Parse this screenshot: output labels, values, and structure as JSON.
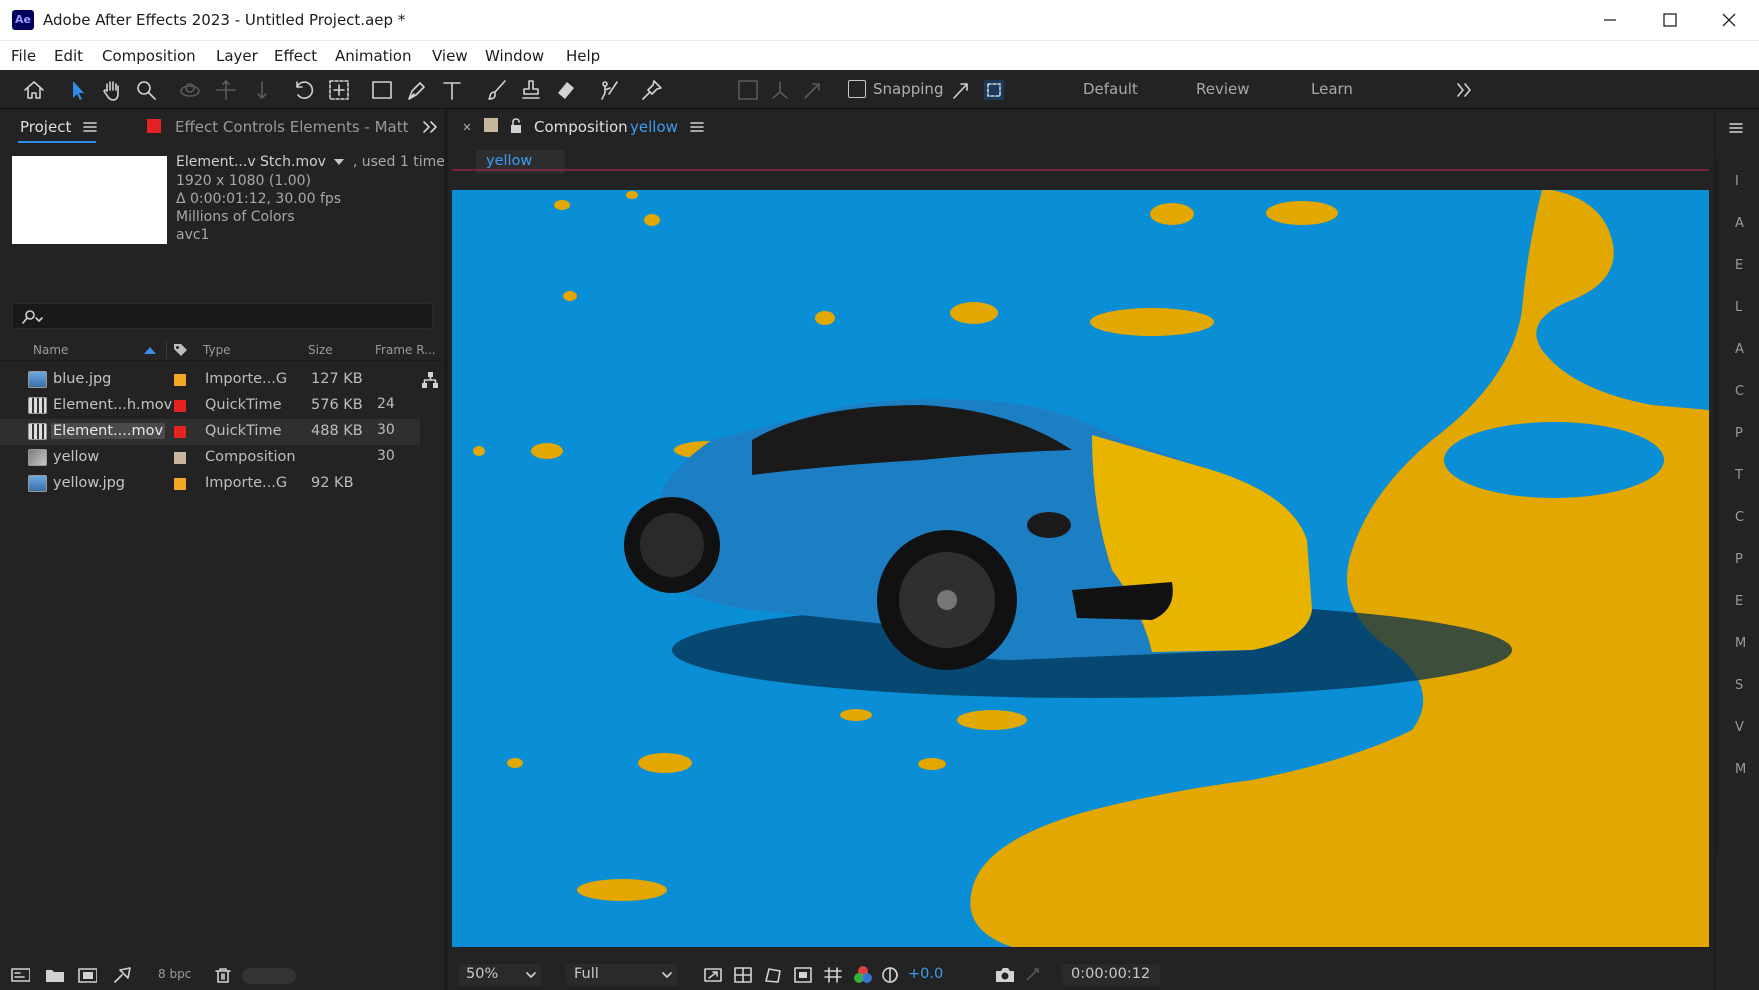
{
  "window": {
    "app_logo": "Ae",
    "title": "Adobe After Effects 2023 - Untitled Project.aep *",
    "controls": [
      "minimize-icon",
      "maximize-icon",
      "close-icon"
    ]
  },
  "menu": [
    "File",
    "Edit",
    "Composition",
    "Layer",
    "Effect",
    "Animation",
    "View",
    "Window",
    "Help"
  ],
  "toolbar": {
    "tools": [
      "home-icon",
      "selection-tool-icon",
      "hand-tool-icon",
      "zoom-tool-icon",
      "orbit-tool-icon",
      "pan-tool-icon",
      "dolly-tool-icon",
      "rotation-tool-icon",
      "pan-behind-tool-icon",
      "rectangle-tool-icon",
      "pen-tool-icon",
      "type-tool-icon",
      "brush-tool-icon",
      "clone-stamp-tool-icon",
      "eraser-tool-icon",
      "roto-brush-tool-icon",
      "puppet-pin-tool-icon"
    ],
    "snapping_label": "Snapping",
    "workspaces": [
      "Default",
      "Review",
      "Learn"
    ],
    "accent_color": "#2d8ceb"
  },
  "project_panel": {
    "tab_project": "Project",
    "tab_effect_controls": "Effect Controls Elements - Matt",
    "selected_info": {
      "name": "Element...v Stch.mov",
      "used": ", used 1 time",
      "line1": "1920 x 1080 (1.00)",
      "line2": "Δ 0:00:01:12, 30.00 fps",
      "line3": "Millions of Colors",
      "line4": "avc1"
    },
    "search_placeholder": "",
    "columns": {
      "name": "Name",
      "type": "Type",
      "size": "Size",
      "frame_rate": "Frame R..."
    },
    "items": [
      {
        "name": "blue.jpg",
        "label_color": "#f5a623",
        "type": "Importe...G",
        "size": "127 KB",
        "frame_rate": "",
        "icon": "image-file-icon"
      },
      {
        "name": "Element...h.mov",
        "label_color": "#e52222",
        "type": "QuickTime",
        "size": "576 KB",
        "frame_rate": "24",
        "icon": "video-file-icon"
      },
      {
        "name": "Element....mov",
        "label_color": "#e52222",
        "type": "QuickTime",
        "size": "488 KB",
        "frame_rate": "30",
        "icon": "video-file-icon",
        "selected": true
      },
      {
        "name": "yellow",
        "label_color": "#c8b79a",
        "type": "Composition",
        "size": "",
        "frame_rate": "30",
        "icon": "composition-icon"
      },
      {
        "name": "yellow.jpg",
        "label_color": "#f5a623",
        "type": "Importe...G",
        "size": "92 KB",
        "frame_rate": "",
        "icon": "image-file-icon"
      }
    ],
    "bit_depth": "8 bpc"
  },
  "composition_panel": {
    "tab_prefix": "Composition",
    "tab_name": "yellow",
    "subtab": "yellow",
    "viewer": {
      "background": "#0a8ed6",
      "paint": "#e2a700",
      "label": "blue sports car with yellow paint splash"
    },
    "zoom": "50%",
    "resolution": "Full",
    "exposure": "+0.0",
    "timecode": "0:00:00:12"
  },
  "right_panel_letters": [
    "I",
    "A",
    "E",
    "L",
    "A",
    "C",
    "P",
    "T",
    "C",
    "P",
    "E",
    "M",
    "S",
    "V",
    "M"
  ]
}
